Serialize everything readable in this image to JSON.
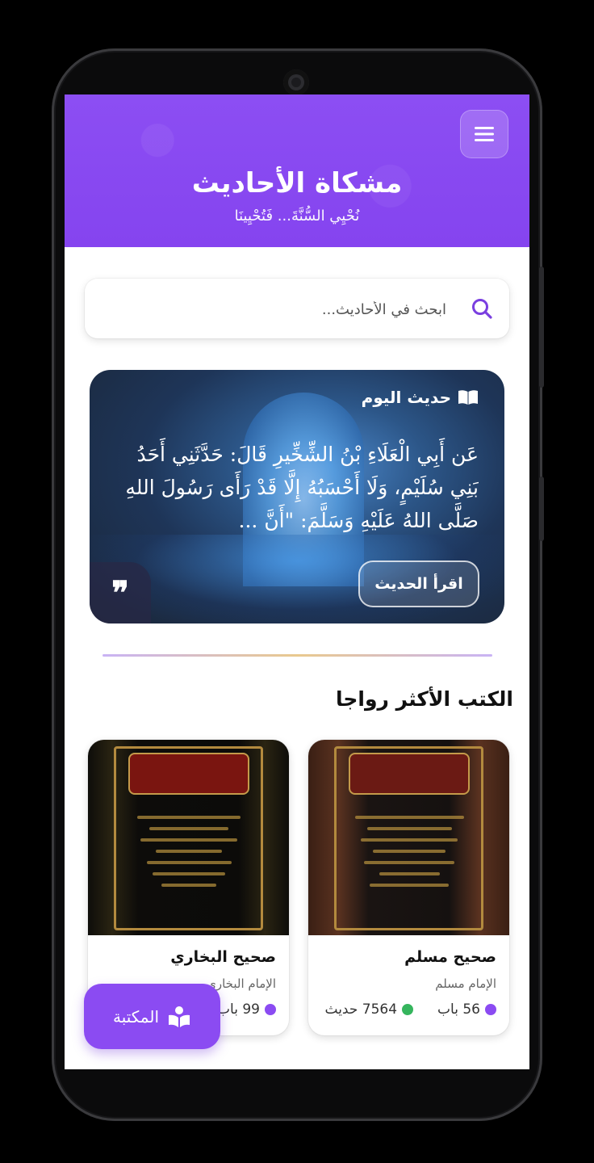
{
  "header": {
    "title": "مشكاة الأحاديث",
    "subtitle": "نُحْيِي السُّنَّةَ... فَتُحْيِينَا"
  },
  "search": {
    "placeholder": "ابحث في الأحاديث..."
  },
  "hadith_of_day": {
    "label": "حديث اليوم",
    "text": "عَن أَبِي الْعَلَاءِ بْنُ الشِّخِّيرِ قَالَ: حَدَّثَنِي أَحَدُ بَنِي سُلَيْمٍ، وَلَا أَحْسَبُهُ إِلَّا قَدْ رَأَى رَسُولَ اللهِ صَلَّى اللهُ عَلَيْهِ وَسَلَّمَ: \"أَنَّ ...",
    "read_button": "اقرأ الحديث",
    "quote_mark": "❞"
  },
  "section": {
    "title": "الكتب الأكثر رواجا"
  },
  "books": [
    {
      "title": "صحيح مسلم",
      "author": "الإمام مسلم",
      "chapters": "56 باب",
      "hadiths": "7564 حديث"
    },
    {
      "title": "صحيح البخاري",
      "author": "الإمام البخاري",
      "chapters": "99 باب"
    }
  ],
  "fab": {
    "label": "المكتبة"
  },
  "colors": {
    "primary": "#8b4bf2",
    "green": "#35b55d"
  }
}
